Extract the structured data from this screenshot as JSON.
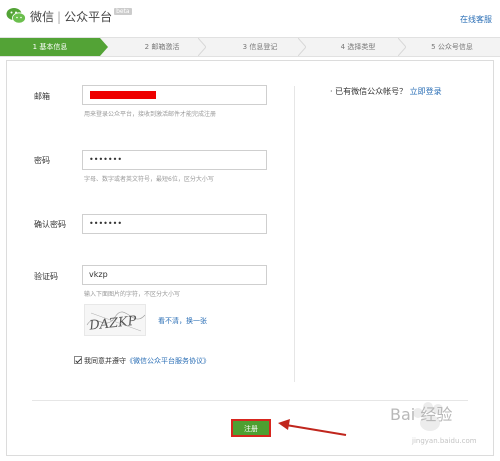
{
  "header": {
    "brand": "微信",
    "separator": "|",
    "platform": "公众平台",
    "beta": "beta",
    "help_link": "在线客服"
  },
  "steps": [
    {
      "label": "1 基本信息",
      "active": true
    },
    {
      "label": "2 邮箱激活",
      "active": false
    },
    {
      "label": "3 信息登记",
      "active": false
    },
    {
      "label": "4 选择类型",
      "active": false
    },
    {
      "label": "5 公众号信息",
      "active": false
    }
  ],
  "form": {
    "email": {
      "label": "邮箱",
      "hint": "用来登录公众平台，接收到激活邮件才能完成注册"
    },
    "password": {
      "label": "密码",
      "value": "•••••••",
      "hint": "字母、数字或者英文符号，最短6位，区分大小写"
    },
    "confirm": {
      "label": "确认密码",
      "value": "•••••••"
    },
    "captcha": {
      "label": "验证码",
      "value": "vkzp",
      "hint": "输入下面图片的字符，不区分大小写",
      "image_text": "DAZKP",
      "refresh": "看不清，换一张"
    },
    "agree": {
      "text": "我同意并遵守",
      "link": "《微信公众平台服务协议》"
    }
  },
  "side": {
    "question": "已有微信公众帐号？",
    "login_link": "立即登录"
  },
  "register_label": "注册",
  "watermark": {
    "text": "Bai 经验",
    "url": "jingyan.baidu.com"
  },
  "colors": {
    "accent": "#53a336",
    "link": "#2b6fb6",
    "highlight": "#d7261e"
  }
}
